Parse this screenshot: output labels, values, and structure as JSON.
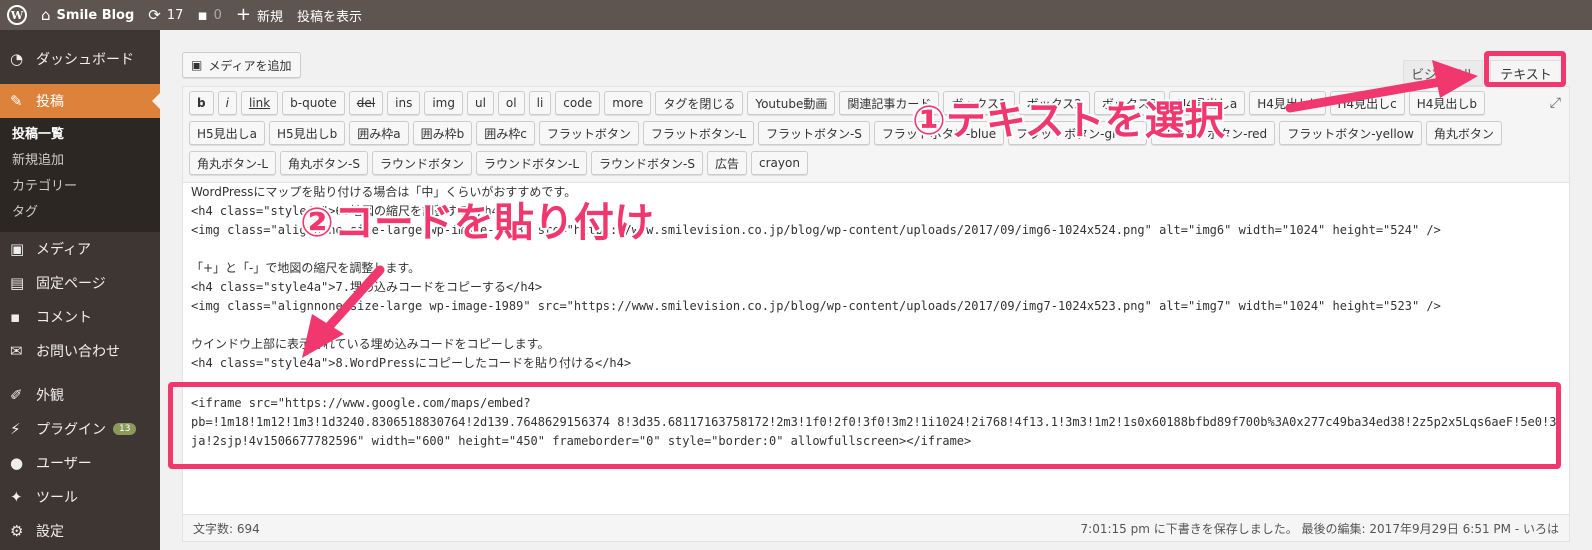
{
  "adminbar": {
    "site_name": "Smile Blog",
    "updates_count": "17",
    "comments_count": "0",
    "new_label": "新規",
    "view_post_label": "投稿を表示"
  },
  "sidebar": {
    "dashboard": "ダッシュボード",
    "posts": "投稿",
    "posts_sub": [
      "投稿一覧",
      "新規追加",
      "カテゴリー",
      "タグ"
    ],
    "media": "メディア",
    "pages": "固定ページ",
    "comments": "コメント",
    "contact": "お問い合わせ",
    "appearance": "外観",
    "plugins": "プラグイン",
    "plugins_badge": "13",
    "users": "ユーザー",
    "tools": "ツール",
    "settings": "設定"
  },
  "editor": {
    "add_media": "メディアを追加",
    "tab_visual": "ビジュアル",
    "tab_text": "テキスト",
    "toolbar_row1": [
      "b",
      "i",
      "link",
      "b-quote",
      "del",
      "ins",
      "img",
      "ul",
      "ol",
      "li",
      "code",
      "more",
      "タグを閉じる",
      "Youtube動画",
      "関連記事カード",
      "ボックス1",
      "ボックス2",
      "ボックス3",
      "H4見出しa",
      "H4見出しb",
      "H4見出しc",
      "H4見出しb"
    ],
    "toolbar_row2": [
      "H5見出しa",
      "H5見出しb",
      "囲み枠a",
      "囲み枠b",
      "囲み枠c",
      "フラットボタン",
      "フラットボタン-L",
      "フラットボタン-S",
      "フラットボタン-blue",
      "フラットボタン-green",
      "フラットボタン-red",
      "フラットボタン-yellow",
      "角丸ボタン"
    ],
    "toolbar_row3": [
      "角丸ボタン-L",
      "角丸ボタン-S",
      "ラウンドボタン",
      "ラウンドボタン-L",
      "ラウンドボタン-S",
      "広告",
      "crayon"
    ],
    "code_lines": [
      "WordPressにマップを貼り付ける場合は「中」くらいがおすすめです。",
      "<h4 class=\"style4a\">6.地図の縮尺を調整する</h4>",
      "<img class=\"alignnone size-large wp-image-1988\" src=\"https://www.smilevision.co.jp/blog/wp-content/uploads/2017/09/img6-1024x524.png\" alt=\"img6\" width=\"1024\" height=\"524\" />",
      "",
      "「+」と「-」で地図の縮尺を調整します。",
      "<h4 class=\"style4a\">7.埋め込みコードをコピーする</h4>",
      "<img class=\"alignnone size-large wp-image-1989\" src=\"https://www.smilevision.co.jp/blog/wp-content/uploads/2017/09/img7-1024x523.png\" alt=\"img7\" width=\"1024\" height=\"523\" />",
      "",
      "ウインドウ上部に表示されている埋め込みコードをコピーします。",
      "<h4 class=\"style4a\">8.WordPressにコピーしたコードを貼り付ける</h4>"
    ],
    "iframe_lines": [
      "<iframe src=\"https://www.google.com/maps/embed?",
      "pb=!1m18!1m12!1m3!1d3240.8306518830764!2d139.7648629156374 8!3d35.68117163758172!2m3!1f0!2f0!3f0!3m2!1i1024!2i768!4f13.1!3m3!1m2!1s0x60188bfbd89f700b%3A0x277c49ba34ed38!2z5p2x5Lqs6aeF!5e0!3m2!1s",
      "ja!2sjp!4v1506677782596\" width=\"600\" height=\"450\" frameborder=\"0\" style=\"border:0\" allowfullscreen></iframe>"
    ],
    "word_count": "文字数: 694",
    "save_status": "7:01:15 pm に下書きを保存しました。 最後の編集: 2017年9月29日 6:51 PM - いろは"
  },
  "annotations": {
    "step1": "①テキストを選択",
    "step2": "②コードを貼り付け",
    "color": "#f0386f"
  }
}
